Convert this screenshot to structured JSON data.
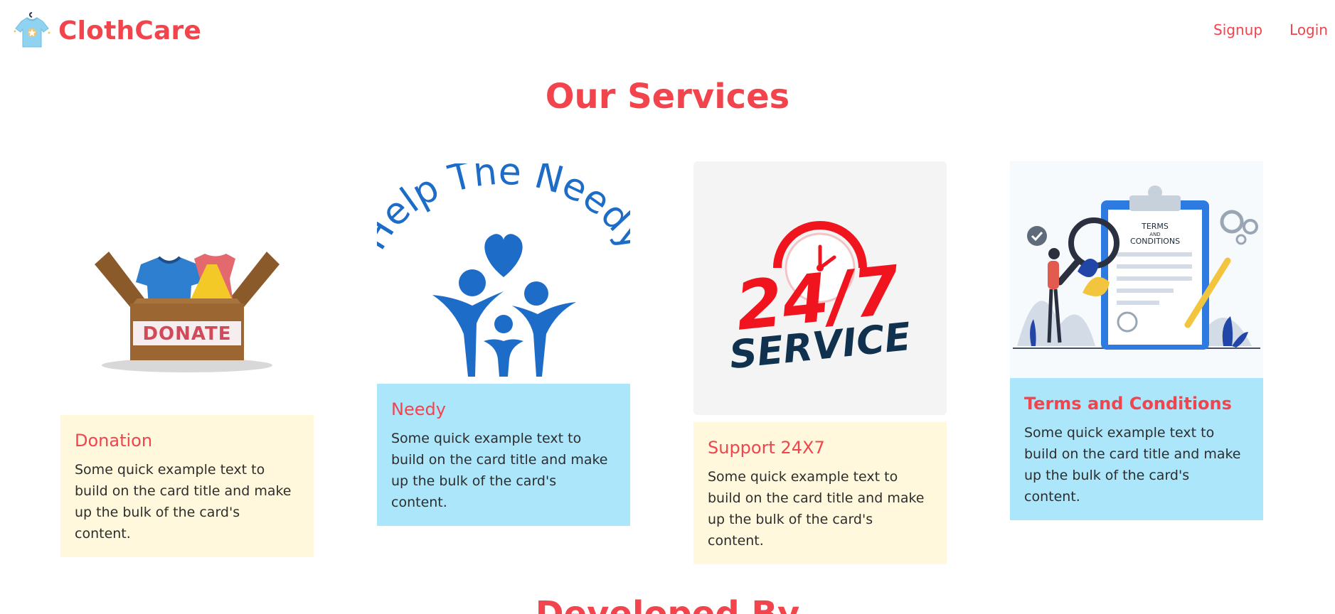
{
  "navbar": {
    "brand": "ClothCare",
    "logo_icon": "tshirt-icon",
    "links": [
      {
        "label": "Signup"
      },
      {
        "label": "Login"
      }
    ]
  },
  "services": {
    "title": "Our Services",
    "cards": [
      {
        "image_icon": "donate-box-icon",
        "image_text": "DONATE",
        "title": "Donation",
        "text": "Some quick example text to build on the card title and make up the bulk of the card's content."
      },
      {
        "image_icon": "help-the-needy-icon",
        "image_text": "Help The Needy",
        "title": "Needy",
        "text": "Some quick example text to build on the card title and make up the bulk of the card's content."
      },
      {
        "image_icon": "support-247-icon",
        "image_text_main": "24/7",
        "image_text_sub": "SERVICE",
        "title": "Support 24X7",
        "text": "Some quick example text to build on the card title and make up the bulk of the card's content."
      },
      {
        "image_icon": "terms-clipboard-icon",
        "image_text_top": "TERMS",
        "image_text_mid": "AND",
        "image_text_bottom": "CONDITIONS",
        "title": "Terms and Conditions",
        "text": "Some quick example text to build on the card title and make up the bulk of the card's content."
      }
    ]
  },
  "developed": {
    "title": "Developed By"
  },
  "colors": {
    "accent": "#f2444d",
    "card_cream": "#fff8dc",
    "card_blue": "#ace6fb"
  }
}
